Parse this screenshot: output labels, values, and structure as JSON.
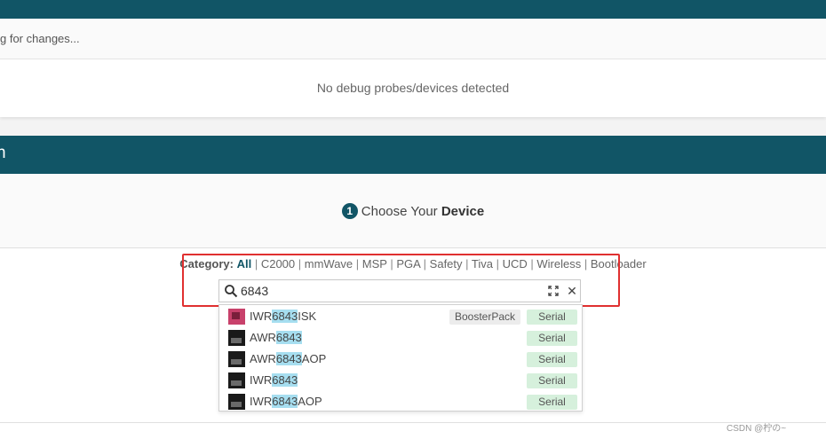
{
  "status": {
    "text": "g for changes..."
  },
  "probes": {
    "message": "No debug probes/devices detected"
  },
  "section": {
    "title": "n"
  },
  "step": {
    "number": "1",
    "text": "Choose Your ",
    "emphasis": "Device"
  },
  "category": {
    "label": "Category:",
    "items": [
      "All",
      "C2000",
      "mmWave",
      "MSP",
      "PGA",
      "Safety",
      "Tiva",
      "UCD",
      "Wireless",
      "Bootloader"
    ],
    "active": "All"
  },
  "search": {
    "value": "6843",
    "icon": "search-icon"
  },
  "results": [
    {
      "prefix": "IWR",
      "match": "6843",
      "suffix": "ISK",
      "badge": "BoosterPack",
      "tag": "Serial",
      "thumb": "pcb"
    },
    {
      "prefix": "AWR",
      "match": "6843",
      "suffix": "",
      "badge": "",
      "tag": "Serial",
      "thumb": "dark"
    },
    {
      "prefix": "AWR",
      "match": "6843",
      "suffix": "AOP",
      "badge": "",
      "tag": "Serial",
      "thumb": "dark"
    },
    {
      "prefix": "IWR",
      "match": "6843",
      "suffix": "",
      "badge": "",
      "tag": "Serial",
      "thumb": "dark"
    },
    {
      "prefix": "IWR",
      "match": "6843",
      "suffix": "AOP",
      "badge": "",
      "tag": "Serial",
      "thumb": "dark"
    }
  ],
  "watermark": "CSDN @柠の~",
  "colors": {
    "brand": "#115566",
    "highlight": "#a6def0",
    "serial_tag": "#d6f0dc",
    "annotation": "#e03030"
  }
}
